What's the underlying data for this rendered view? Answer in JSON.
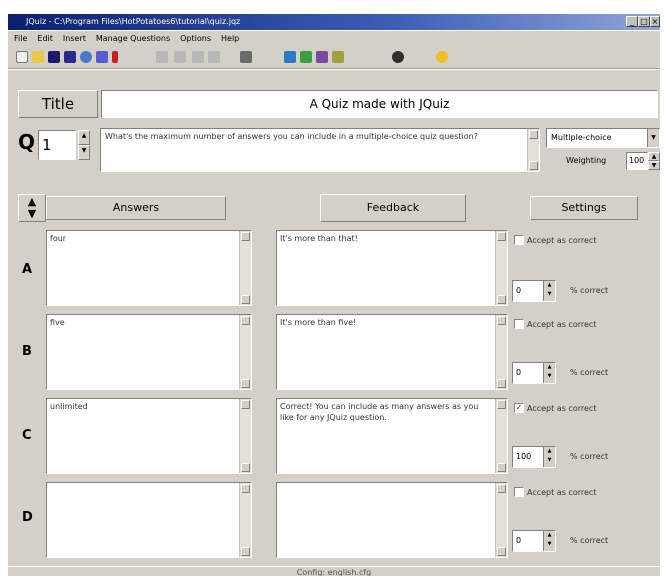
{
  "window": {
    "title": "JQuiz - C:\\Program Files\\HotPotatoes6\\tutorial\\quiz.jqz"
  },
  "menu": [
    "File",
    "Edit",
    "Insert",
    "Manage Questions",
    "Options",
    "Help"
  ],
  "toolbar_icons": [
    "new-icon",
    "open-icon",
    "save-icon",
    "save-as-icon",
    "web-page-icon",
    "export-icon",
    "flag-icon",
    "undo-icon",
    "redo-icon",
    "cut-icon",
    "copy-icon",
    "paste-icon",
    "question-bank-icon",
    "add-question-icon",
    "config-icon",
    "spell-icon",
    "view-icon",
    "help-icon"
  ],
  "title_label": "Title",
  "quiz_title": "A Quiz made with JQuiz",
  "q_label": "Q",
  "question_number": "1",
  "question_text": "What's the maximum number of answers you can include in a multiple-choice quiz question?",
  "question_type": "Multiple-choice",
  "weighting_label": "Weighting",
  "weighting_value": "100",
  "headers": {
    "answers": "Answers",
    "feedback": "Feedback",
    "settings": "Settings"
  },
  "rows": [
    {
      "letter": "A",
      "answer": "four",
      "feedback": "It's more than that!",
      "accept_label": "Accept as correct",
      "accepted": false,
      "percent": "0",
      "percent_label": "% correct"
    },
    {
      "letter": "B",
      "answer": "five",
      "feedback": "It's more than five!",
      "accept_label": "Accept as correct",
      "accepted": false,
      "percent": "0",
      "percent_label": "% correct"
    },
    {
      "letter": "C",
      "answer": "unlimited",
      "feedback": "Correct! You can include as many answers as you like for any JQuiz question.",
      "accept_label": "Accept as correct",
      "accepted": true,
      "percent": "100",
      "percent_label": "% correct"
    },
    {
      "letter": "D",
      "answer": "",
      "feedback": "",
      "accept_label": "Accept as correct",
      "accepted": false,
      "percent": "0",
      "percent_label": "% correct"
    }
  ],
  "status": "Config: english.cfg"
}
